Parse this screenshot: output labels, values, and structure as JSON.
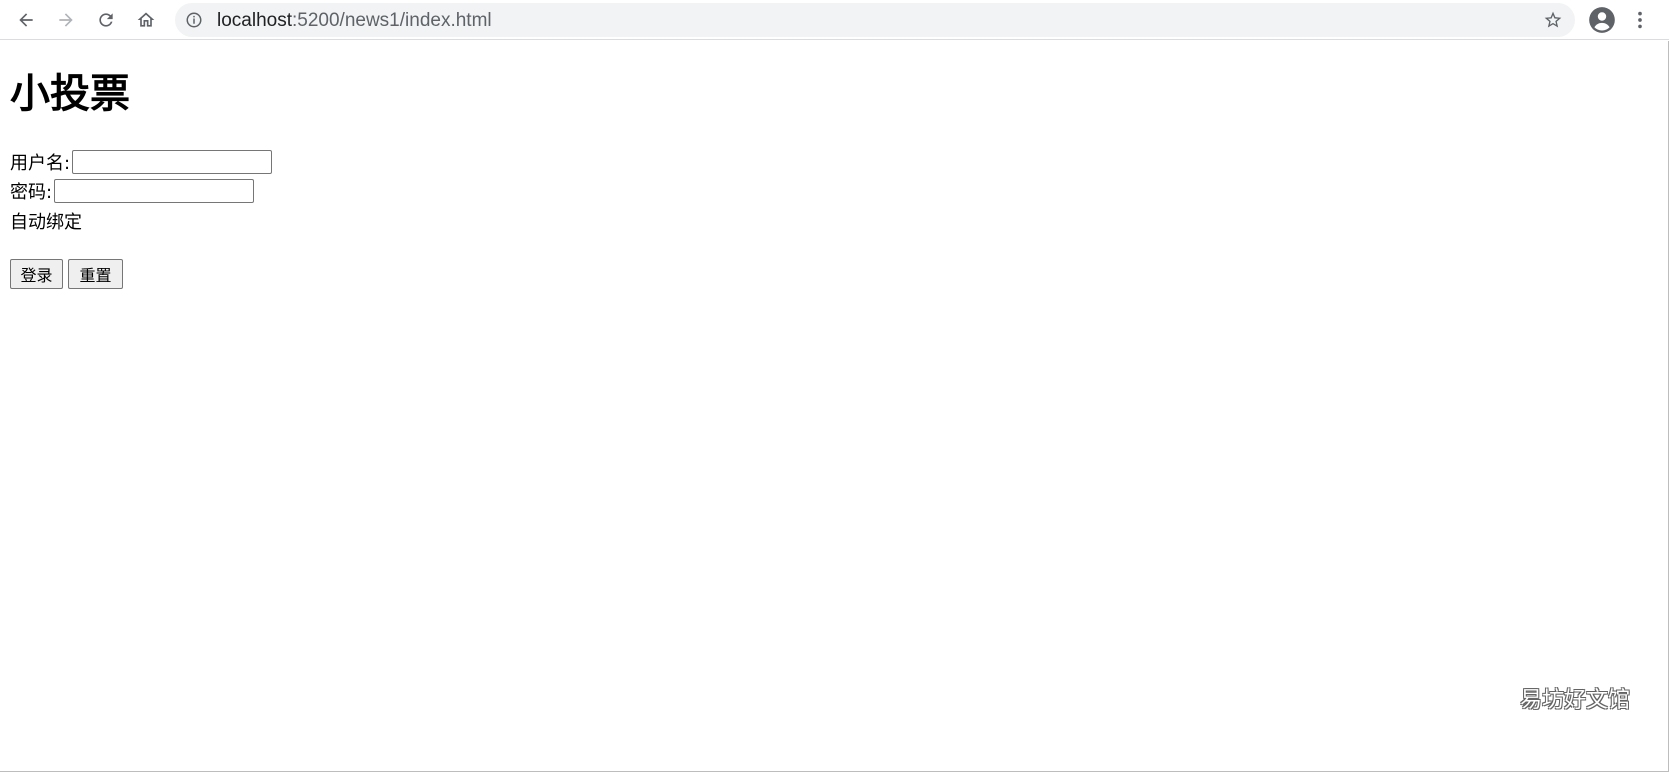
{
  "browser": {
    "url_host": "localhost",
    "url_rest": ":5200/news1/index.html",
    "icons": {
      "back": "back-arrow-icon",
      "forward": "forward-arrow-icon",
      "reload": "reload-icon",
      "home": "home-icon",
      "info": "info-icon",
      "star": "star-icon",
      "profile": "profile-icon",
      "menu": "menu-dots-icon"
    }
  },
  "page": {
    "title": "小投票",
    "username_label": "用户名:",
    "username_value": "",
    "password_label": "密码:",
    "password_value": "",
    "auto_bind_label": "自动绑定",
    "login_button": "登录",
    "reset_button": "重置"
  },
  "watermark": "易坊好文馆"
}
